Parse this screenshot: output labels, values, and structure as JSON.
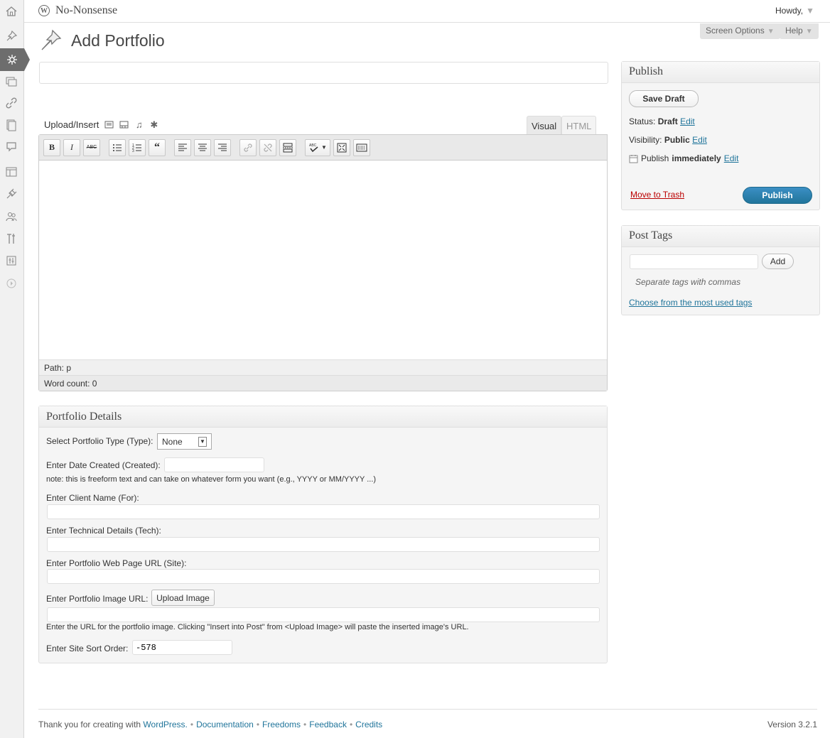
{
  "header": {
    "site_name": "No-Nonsense",
    "howdy": "Howdy,",
    "screen_options": "Screen Options",
    "help": "Help"
  },
  "page": {
    "title": "Add Portfolio"
  },
  "editor": {
    "upload_insert": "Upload/Insert",
    "tab_visual": "Visual",
    "tab_html": "HTML",
    "path": "Path: p",
    "word_count": "Word count: 0"
  },
  "portfolio_details": {
    "heading": "Portfolio Details",
    "type_label": "Select Portfolio Type (Type):",
    "type_value": "None",
    "date_label": "Enter Date Created (Created):",
    "date_note": "note: this is freeform text and can take on whatever form you want (e.g., YYYY or MM/YYYY ...)",
    "client_label": "Enter Client Name (For):",
    "tech_label": "Enter Technical Details (Tech):",
    "site_label": "Enter Portfolio Web Page URL (Site):",
    "image_label": "Enter Portfolio Image URL:",
    "upload_image_button": "Upload Image",
    "image_note": "Enter the URL for the portfolio image. Clicking \"Insert into Post\" from <Upload Image> will paste the inserted image's URL.",
    "sort_label": "Enter Site Sort Order:",
    "sort_value": "-578"
  },
  "publish": {
    "heading": "Publish",
    "save_draft": "Save Draft",
    "status_label": "Status:",
    "status_value": "Draft",
    "visibility_label": "Visibility:",
    "visibility_value": "Public",
    "publish_label": "Publish",
    "publish_value": "immediately",
    "edit": "Edit",
    "move_to_trash": "Move to Trash",
    "publish_button": "Publish"
  },
  "tags": {
    "heading": "Post Tags",
    "add": "Add",
    "hint": "Separate tags with commas",
    "choose": "Choose from the most used tags"
  },
  "footer": {
    "thanks": "Thank you for creating with",
    "wordpress": "WordPress.",
    "documentation": "Documentation",
    "freedoms": "Freedoms",
    "feedback": "Feedback",
    "credits": "Credits",
    "version": "Version 3.2.1"
  },
  "colors": {
    "link": "#21759b",
    "publish_button": "#21759b",
    "trash": "#bb0000"
  },
  "icons": [
    "home-icon",
    "pin-icon",
    "portfolio-icon",
    "media-icon",
    "links-icon",
    "pages-icon",
    "comments-icon",
    "appearance-icon",
    "plugins-icon",
    "users-icon",
    "tools-icon",
    "settings-icon",
    "collapse-icon"
  ]
}
